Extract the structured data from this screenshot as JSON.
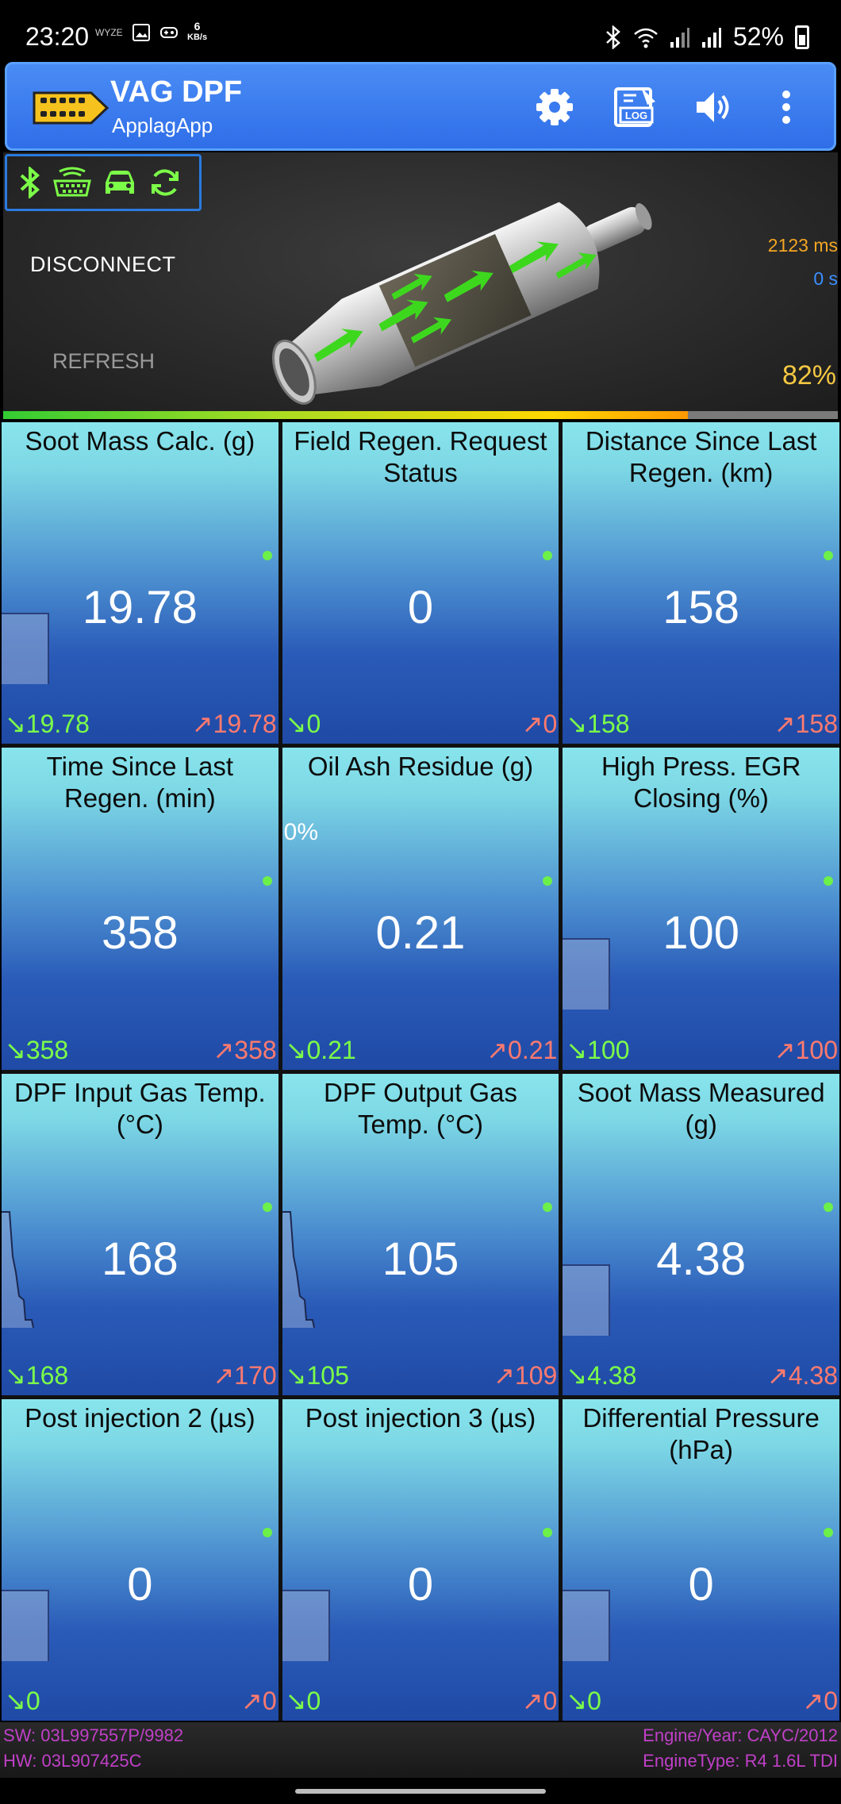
{
  "status_bar": {
    "time": "23:20",
    "net_speed": "6",
    "net_unit": "KB/s",
    "wyze": "WYZE",
    "battery": "52%"
  },
  "app": {
    "title": "VAG DPF",
    "subtitle": "ApplagApp"
  },
  "toolbar": {
    "settings_icon": "gear-icon",
    "log_icon": "log-icon",
    "log_label": "LOG",
    "sound_icon": "speaker-icon",
    "menu_icon": "more-vert-icon"
  },
  "connection": {
    "icons": [
      "bluetooth-icon",
      "obd-adapter-icon",
      "car-icon",
      "sync-icon"
    ],
    "icon_color": "#7cff48",
    "disconnect_label": "DISCONNECT",
    "refresh_label": "REFRESH",
    "latency": "2123 ms",
    "elapsed": "0 s",
    "percent": "82%",
    "progress_fraction": 0.82
  },
  "tiles": [
    {
      "title": "Soot Mass Calc. (g)",
      "value": "19.78",
      "min": "↘19.78",
      "max": "↗19.78",
      "extra": "bar"
    },
    {
      "title": "Field Regen. Request Status",
      "value": "0",
      "min": "↘0",
      "max": "↗0",
      "extra": ""
    },
    {
      "title": "Distance Since Last Regen. (km)",
      "value": "158",
      "min": "↘158",
      "max": "↗158",
      "extra": ""
    },
    {
      "title": "Time Since Last Regen. (min)",
      "value": "358",
      "min": "↘358",
      "max": "↗358",
      "extra": ""
    },
    {
      "title": "Oil Ash Residue (g)",
      "value": "0.21",
      "min": "↘0.21",
      "max": "↗0.21",
      "extra": "pct",
      "pct_label": "0%"
    },
    {
      "title": "High Press. EGR Closing (%)",
      "value": "100",
      "min": "↘100",
      "max": "↗100",
      "extra": "bar"
    },
    {
      "title": "DPF Input Gas Temp. (°C)",
      "value": "168",
      "min": "↘168",
      "max": "↗170",
      "extra": "spark"
    },
    {
      "title": "DPF Output Gas Temp. (°C)",
      "value": "105",
      "min": "↘105",
      "max": "↗109",
      "extra": "spark"
    },
    {
      "title": "Soot Mass Measured (g)",
      "value": "4.38",
      "min": "↘4.38",
      "max": "↗4.38",
      "extra": "bar"
    },
    {
      "title": "Post injection 2 (µs)",
      "value": "0",
      "min": "↘0",
      "max": "↗0",
      "extra": "bar"
    },
    {
      "title": "Post injection 3 (µs)",
      "value": "0",
      "min": "↘0",
      "max": "↗0",
      "extra": "bar"
    },
    {
      "title": "Differential Pressure (hPa)",
      "value": "0",
      "min": "↘0",
      "max": "↗0",
      "extra": "bar"
    }
  ],
  "footer": {
    "sw": "SW: 03L997557P/9982",
    "hw": "HW: 03L907425C",
    "engine_year": "Engine/Year: CAYC/2012",
    "engine_type": "EngineType: R4 1.6L TDI"
  }
}
